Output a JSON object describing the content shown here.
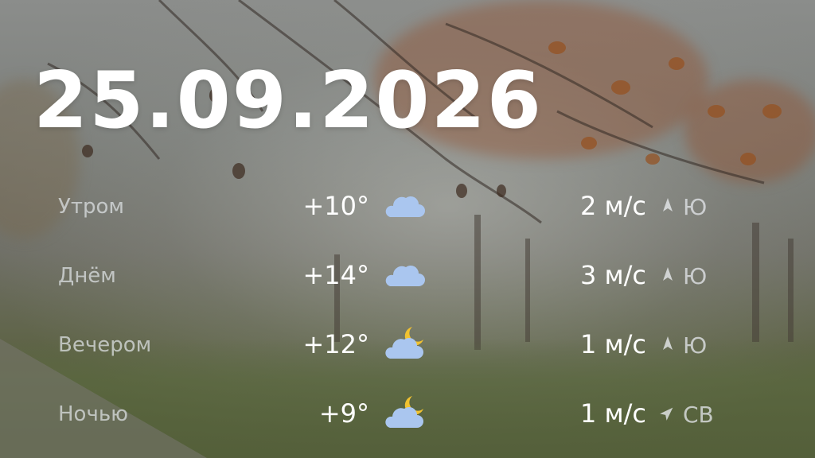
{
  "date": "25.09.2026",
  "forecast": [
    {
      "period": "Утром",
      "temp": "+10°",
      "icon": "cloud-icon",
      "wind": "2 м/с",
      "direction": "Ю",
      "wind_angle": 0
    },
    {
      "period": "Днём",
      "temp": "+14°",
      "icon": "cloud-icon",
      "wind": "3 м/с",
      "direction": "Ю",
      "wind_angle": 0
    },
    {
      "period": "Вечером",
      "temp": "+12°",
      "icon": "cloud-moon-icon",
      "wind": "1 м/с",
      "direction": "Ю",
      "wind_angle": 0
    },
    {
      "period": "Ночью",
      "temp": "+9°",
      "icon": "cloud-moon-icon",
      "wind": "1 м/с",
      "direction": "СВ",
      "wind_angle": 45
    }
  ],
  "colors": {
    "cloud": "#aac6ef",
    "moon": "#f2c230",
    "text": "#ffffff",
    "label": "#e1e4e8"
  }
}
